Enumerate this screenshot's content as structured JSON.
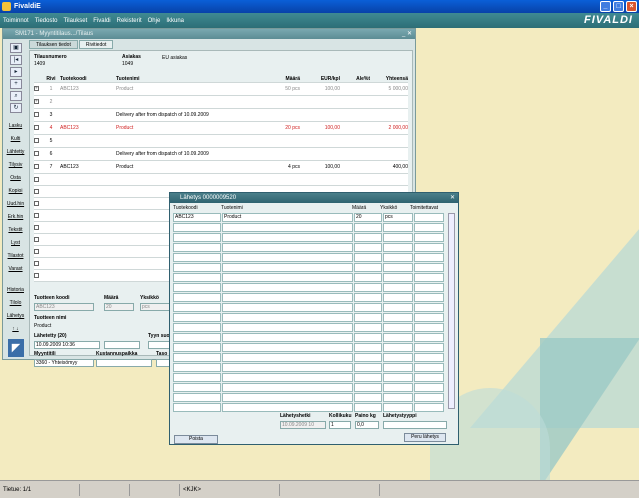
{
  "app": {
    "title": "FivaldiE",
    "logo": "FIVALDI"
  },
  "menu": [
    "Toiminnot",
    "Tiedosto",
    "Tilaukset",
    "Fivaldi",
    "Rekisterit",
    "Ohje",
    "Ikkuna"
  ],
  "main_window": {
    "title": "SM171 - Myyntitilaus.../Tilaus",
    "tabs": [
      "Tilauksen tiedot",
      "Rivitiedot"
    ],
    "header": {
      "order_no_label": "Tilausnumero",
      "order_no": "1409",
      "customer_label": "Asiakas",
      "customer_no": "1049",
      "customer_name": "EU asiakas"
    },
    "sidebar_buttons": [
      "Lasku",
      "Kulti",
      "Lähtetty",
      "Tilysiv",
      "Osta",
      "Kopioi",
      "Uud.hin",
      "Erk.hin",
      "Tekstit",
      "Lyst",
      "Tilastot",
      "Varast",
      "Historia",
      "Tilolo",
      "Lähetys"
    ],
    "grid": {
      "headers": [
        "Rivi",
        "Tuotekoodi",
        "Tuotenimi",
        "Määrä",
        "EUR/kpl",
        "Ale%t",
        "Yhteensä"
      ],
      "rows": [
        {
          "checked": true,
          "rivi": "1",
          "code": "ABC123",
          "name": "Product",
          "qty": "50  pcs",
          "price": "100,00",
          "ale": "",
          "total": "5 000,00",
          "style": "grey"
        },
        {
          "checked": true,
          "rivi": "2",
          "code": "",
          "name": "",
          "qty": "",
          "price": "",
          "ale": "",
          "total": "",
          "style": "grey"
        },
        {
          "checked": false,
          "rivi": "3",
          "code": "",
          "name": "Delivery after from dispatch of 10.09.2009",
          "qty": "",
          "price": "",
          "ale": "",
          "total": "",
          "style": ""
        },
        {
          "checked": false,
          "rivi": "4",
          "code": "ABC123",
          "name": "Product",
          "qty": "20  pcs",
          "price": "100,00",
          "ale": "",
          "total": "2 000,00",
          "style": "red"
        },
        {
          "checked": false,
          "rivi": "5",
          "code": "",
          "name": "",
          "qty": "",
          "price": "",
          "ale": "",
          "total": "",
          "style": ""
        },
        {
          "checked": false,
          "rivi": "6",
          "code": "",
          "name": "Delivery after from dispatch of 10.09.2009",
          "qty": "",
          "price": "",
          "ale": "",
          "total": "",
          "style": ""
        },
        {
          "checked": false,
          "rivi": "7",
          "code": "ABC123",
          "name": "Product",
          "qty": "4  pcs",
          "price": "100,00",
          "ale": "",
          "total": "400,00",
          "style": ""
        }
      ]
    },
    "lower": {
      "product_code_label": "Tuotteen koodi",
      "product_code": "ABC123",
      "qty_label": "Määrä",
      "qty": "20",
      "unit_label": "Yksikkö",
      "unit": "pcs",
      "product_name_label": "Tuotteen nimi",
      "product_name": "Product",
      "shipped_label": "Lähetetty (20)",
      "shipped_date": "10.09.2009 10:36",
      "type_label": "Tyyn suo",
      "account_label": "Myyntitili",
      "account": "3360 - Yhteisömyy",
      "cost_center_label": "Kustannuspaikka",
      "level_label": "Taso 3"
    }
  },
  "dialog": {
    "title": "Lähetys 0000009520",
    "headers": [
      "Tuotekoodi",
      "Tuotenimi",
      "Määrä",
      "Yksikkö",
      "Toimitettavat"
    ],
    "rows": [
      {
        "code": "ABC123",
        "name": "Product",
        "qty": "20",
        "unit": "pcs",
        "deliver": ""
      }
    ],
    "footer": {
      "send_date_label": "Lähetyshetki",
      "send_date": "10.09.2009 10",
      "packages_label": "Kollikuku",
      "packages": "1",
      "weight_label": "Paino kg",
      "weight": "0,0",
      "type_label": "Lähetystyyppi",
      "type": "",
      "delete_label": "Poista",
      "cancel_label": "Peru lähetys"
    }
  },
  "statusbar": {
    "left": "Tietue: 1/1",
    "mode": "<KJK>"
  }
}
